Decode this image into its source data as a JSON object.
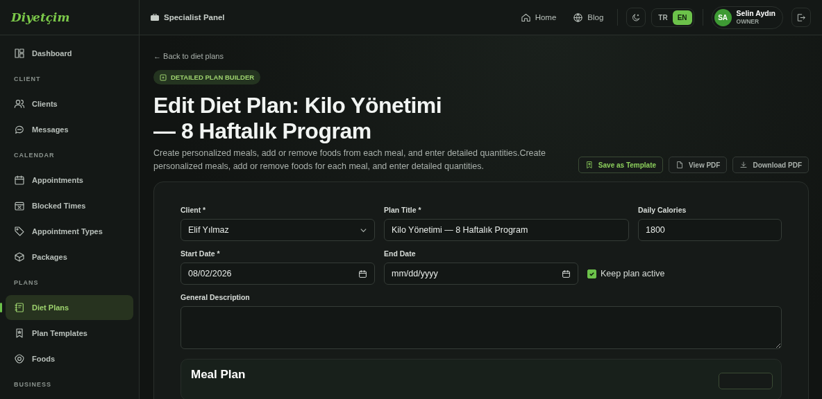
{
  "brand": {
    "logo": "Diyetçim"
  },
  "header": {
    "panel_label": "Specialist Panel",
    "nav": [
      {
        "label": "Home"
      },
      {
        "label": "Blog"
      }
    ],
    "languages": [
      {
        "label": "TR",
        "selected": false
      },
      {
        "label": "EN",
        "selected": true
      }
    ],
    "user": {
      "initials": "SA",
      "name": "Selin Aydın",
      "role": "OWNER"
    }
  },
  "sidebar": {
    "sections": [
      {
        "items": [
          {
            "label": "Dashboard",
            "selected": false
          }
        ]
      },
      {
        "title": "CLIENT",
        "items": [
          {
            "label": "Clients",
            "selected": false
          },
          {
            "label": "Messages",
            "selected": false
          }
        ]
      },
      {
        "title": "CALENDAR",
        "items": [
          {
            "label": "Appointments",
            "selected": false
          },
          {
            "label": "Blocked Times",
            "selected": false
          },
          {
            "label": "Appointment Types",
            "selected": false
          },
          {
            "label": "Packages",
            "selected": false
          }
        ]
      },
      {
        "title": "PLANS",
        "items": [
          {
            "label": "Diet Plans",
            "selected": true
          },
          {
            "label": "Plan Templates",
            "selected": false
          },
          {
            "label": "Foods",
            "selected": false
          }
        ]
      },
      {
        "title": "BUSINESS"
      }
    ]
  },
  "page": {
    "back_link": "← Back to diet plans",
    "badge": "DETAILED PLAN BUILDER",
    "title": "Edit Diet Plan: Kilo Yönetimi — 8 Haftalık Program",
    "description": "Create personalized meals, add or remove foods from each meal, and enter detailed quantities.Create personalized meals, add or remove foods for each meal, and enter detailed quantities.",
    "actions": [
      {
        "label": "Save as Template",
        "kind": "primary"
      },
      {
        "label": "View PDF",
        "kind": "secondary"
      },
      {
        "label": "Download PDF",
        "kind": "secondary"
      }
    ]
  },
  "form": {
    "client": {
      "label": "Client *",
      "value": "Elif Yılmaz"
    },
    "plan_title": {
      "label": "Plan Title *",
      "value": "Kilo Yönetimi — 8 Haftalık Program"
    },
    "daily_calories": {
      "label": "Daily Calories",
      "value": "1800"
    },
    "start_date": {
      "label": "Start Date *",
      "value": "08/02/2026"
    },
    "end_date": {
      "label": "End Date",
      "placeholder": "mm/dd/yyyy"
    },
    "keep_active": {
      "label": "Keep plan active",
      "checked": true
    },
    "description": {
      "label": "General Description"
    }
  },
  "meal_plan": {
    "title": "Meal Plan"
  }
}
